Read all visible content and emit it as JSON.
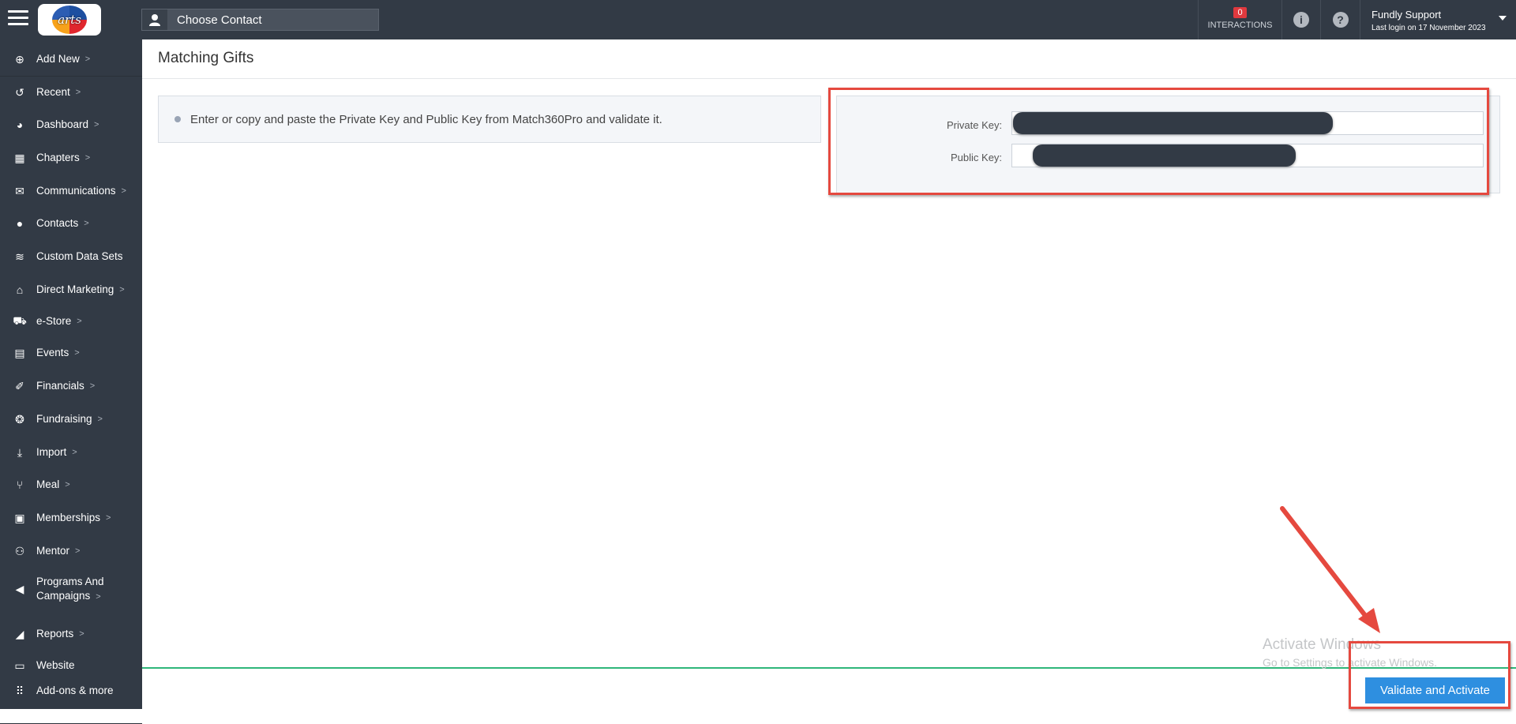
{
  "topbar": {
    "logo_text": "arts",
    "contact_placeholder": "Choose Contact",
    "interactions_count": "0",
    "interactions_label": "INTERACTIONS",
    "user_name": "Fundly Support",
    "last_login": "Last login on 17 November 2023"
  },
  "sidebar": {
    "items": [
      {
        "label": "Add New",
        "icon": "plus-circle-icon",
        "chevron": true
      },
      {
        "label": "Recent",
        "icon": "history-icon",
        "chevron": true
      },
      {
        "label": "Dashboard",
        "icon": "dashboard-gauge-icon",
        "chevron": true
      },
      {
        "label": "Chapters",
        "icon": "grid-squares-icon",
        "chevron": true
      },
      {
        "label": "Communications",
        "icon": "envelope-icon",
        "chevron": true
      },
      {
        "label": "Contacts",
        "icon": "person-icon",
        "chevron": true
      },
      {
        "label": "Custom Data Sets",
        "icon": "layers-icon",
        "chevron": false
      },
      {
        "label": "Direct Marketing",
        "icon": "inbox-icon",
        "chevron": true
      },
      {
        "label": "e-Store",
        "icon": "cart-icon",
        "chevron": true
      },
      {
        "label": "Events",
        "icon": "calendar-icon",
        "chevron": true
      },
      {
        "label": "Financials",
        "icon": "ticket-icon",
        "chevron": true
      },
      {
        "label": "Fundraising",
        "icon": "money-bag-icon",
        "chevron": true
      },
      {
        "label": "Import",
        "icon": "download-icon",
        "chevron": true
      },
      {
        "label": "Meal",
        "icon": "fork-knife-icon",
        "chevron": true
      },
      {
        "label": "Memberships",
        "icon": "id-card-icon",
        "chevron": true
      },
      {
        "label": "Mentor",
        "icon": "people-running-icon",
        "chevron": true
      },
      {
        "label": "Programs And",
        "label2": "Campaigns",
        "icon": "megaphone-icon",
        "chevron": true
      },
      {
        "label": "Reports",
        "icon": "chart-area-icon",
        "chevron": true
      },
      {
        "label": "Website",
        "icon": "monitor-icon",
        "chevron": false
      },
      {
        "label": "Add-ons & more",
        "icon": "apps-grid-icon",
        "chevron": false
      }
    ],
    "chevron": ">"
  },
  "main": {
    "title": "Matching Gifts",
    "info_text": "Enter or copy and paste the Private Key and Public Key from Match360Pro and validate it.",
    "private_key_label": "Private Key:",
    "public_key_label": "Public Key:",
    "validate_label": "Validate and Activate"
  },
  "watermark": {
    "line1": "Activate Windows",
    "line2": "Go to Settings to activate Windows."
  },
  "colors": {
    "topbar_bg": "#323a45",
    "badge_red": "#e0393e",
    "annotation_red": "#e5493f",
    "button_blue": "#2e8fe0",
    "divider_green": "#2fb67a"
  }
}
